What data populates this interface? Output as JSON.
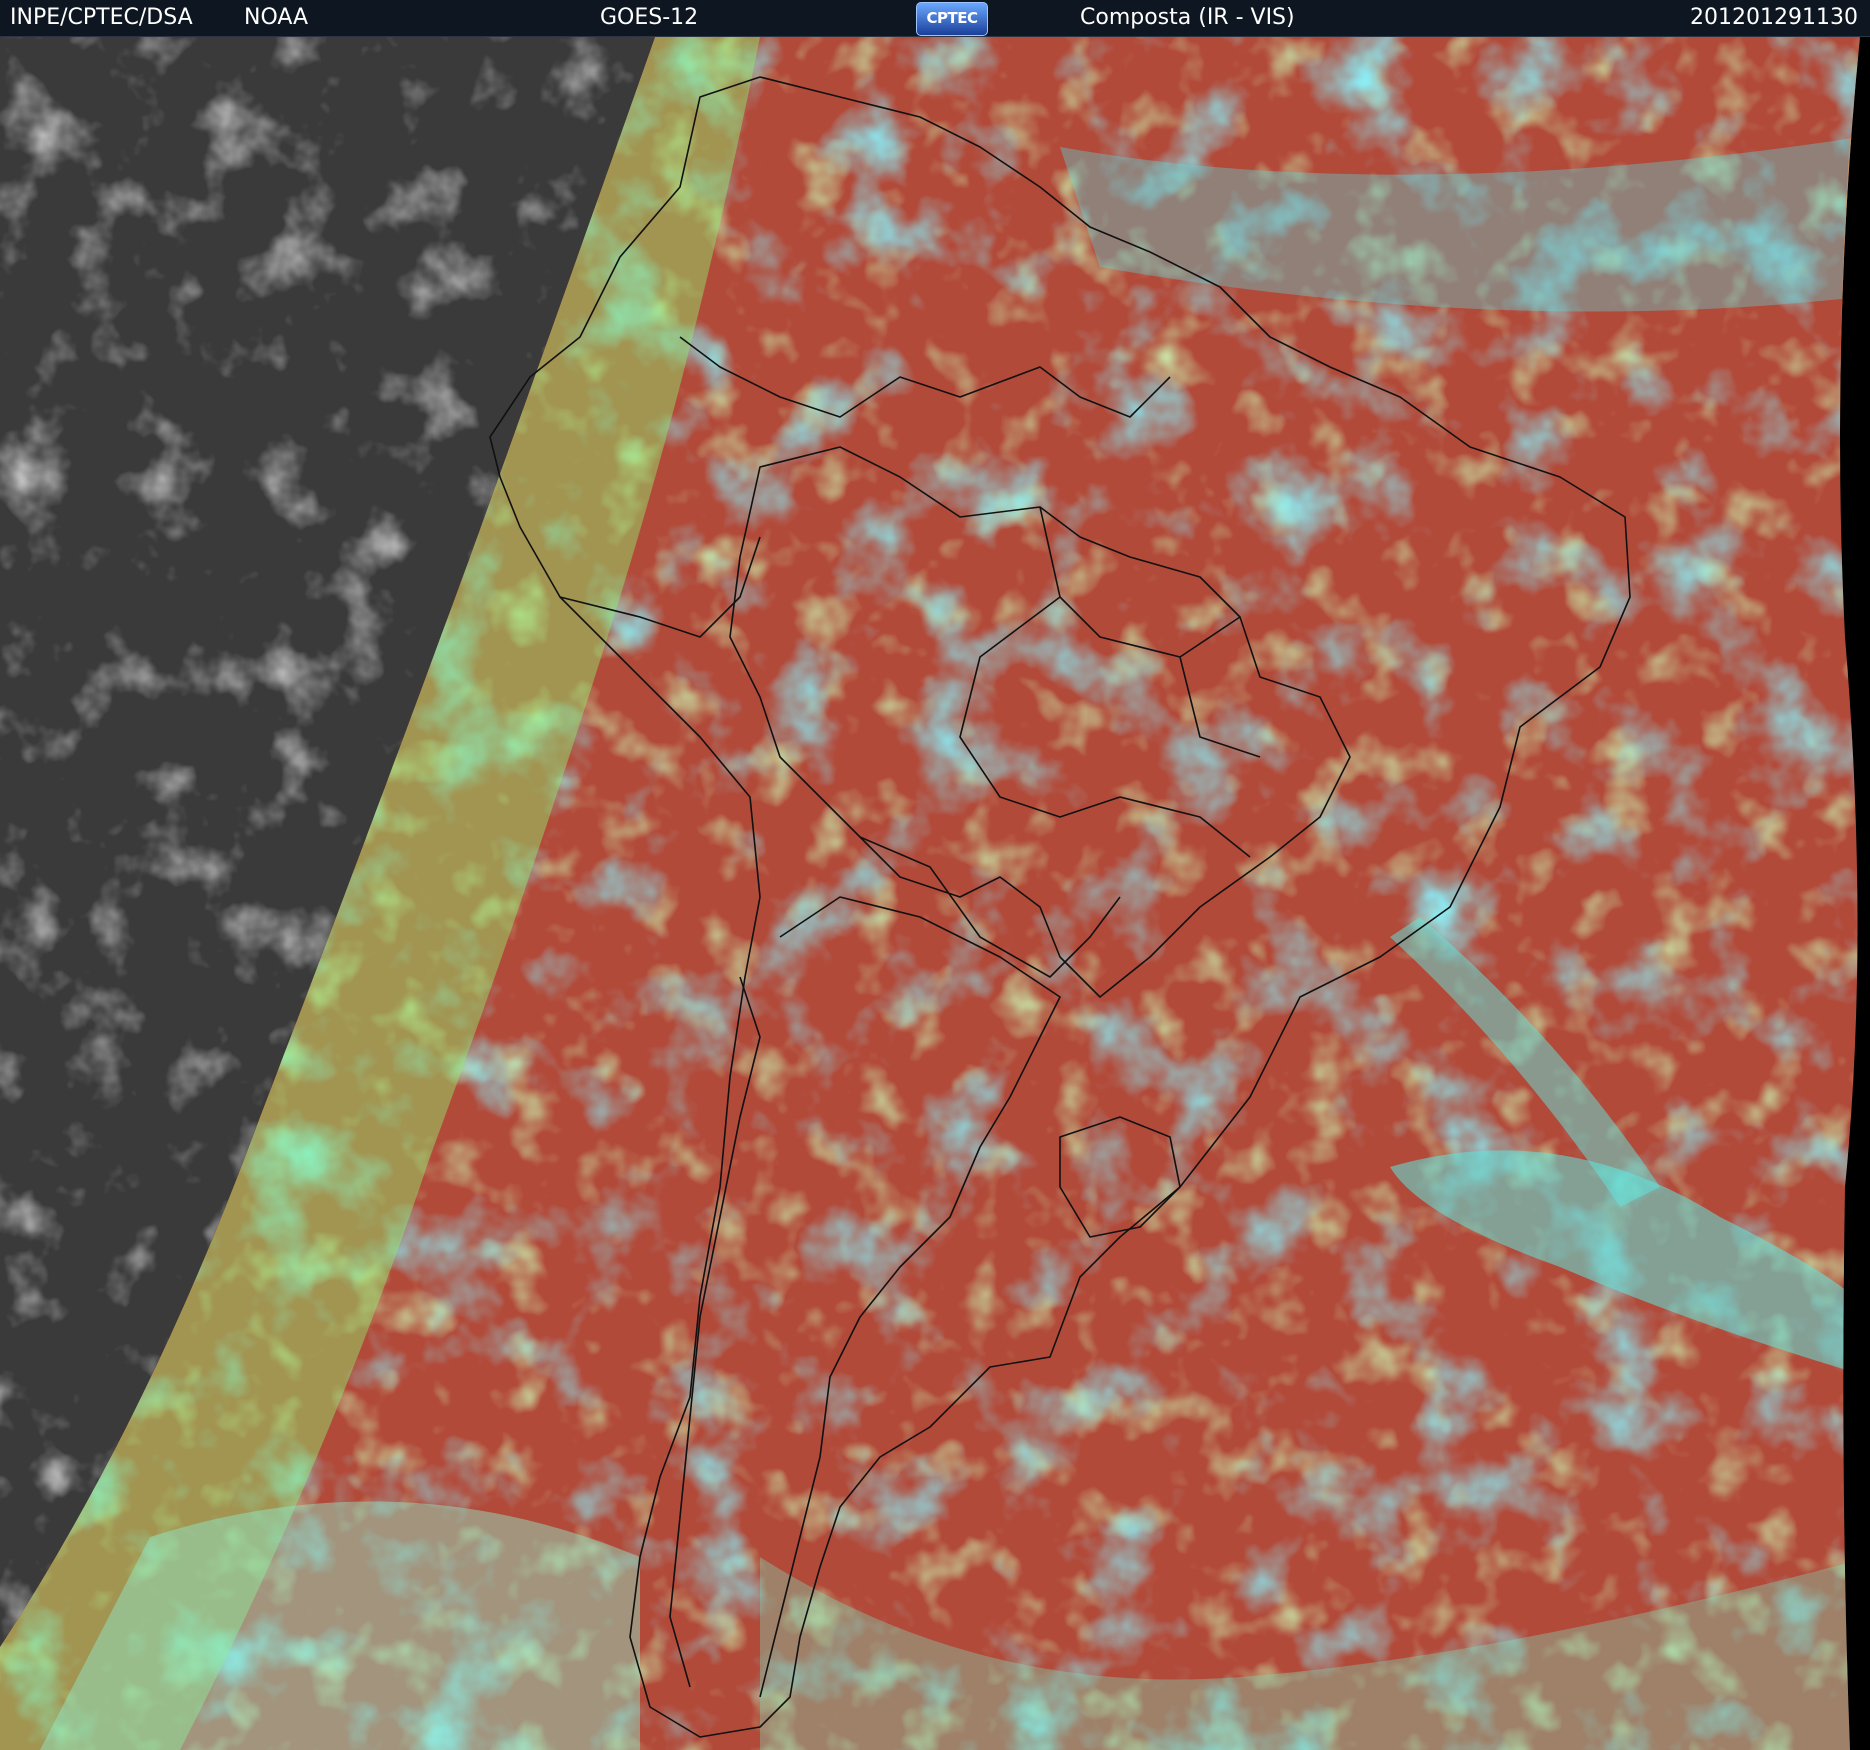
{
  "header": {
    "source": "INPE/CPTEC/DSA",
    "agency": "NOAA",
    "satellite": "GOES-12",
    "logo_text": "CPTEC",
    "product": "Composta (IR - VIS)",
    "timestamp": "201201291130"
  },
  "colors": {
    "header_bg": "#0e1621",
    "night_side": "#3a3a3a",
    "clear_sky_red": "#b24a3a",
    "high_cloud_cyan": "#3fe0ff",
    "low_cloud_green": "#9ef07a",
    "border_lines": "#111111"
  },
  "map_layers": [
    "night-side-grayscale",
    "day-side-composite",
    "political-borders"
  ]
}
